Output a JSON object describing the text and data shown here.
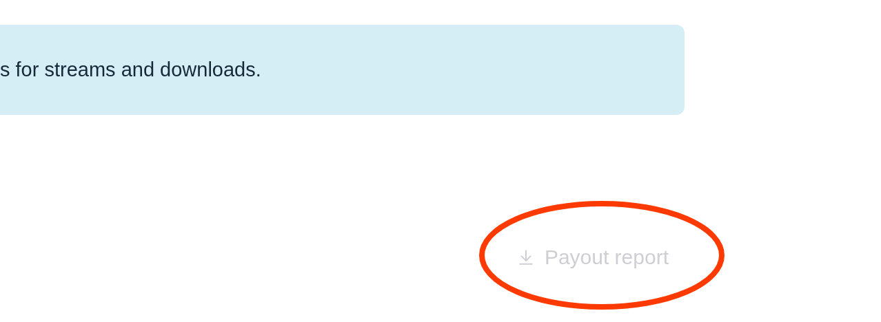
{
  "banner": {
    "text": "s for streams and downloads."
  },
  "payout_button": {
    "label": "Payout report",
    "disabled": true
  }
}
